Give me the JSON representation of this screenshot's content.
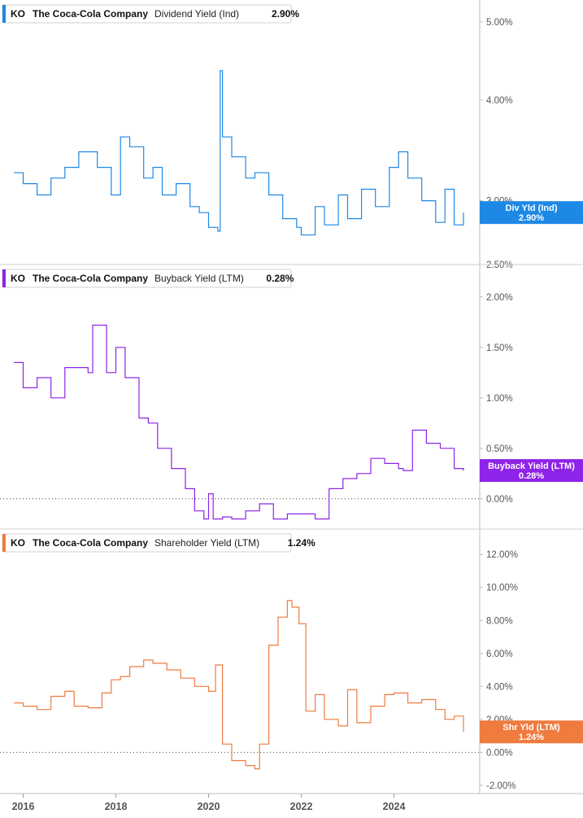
{
  "chart_data": [
    {
      "type": "line",
      "ticker": "KO",
      "company": "The Coca-Cola Company",
      "metric": "Dividend Yield (Ind)",
      "current_value": "2.90%",
      "flag_label": "Div Yld (Ind)",
      "color": "#1e88e5",
      "y_scale": "log",
      "ylim": [
        2.5,
        5.2
      ],
      "y_ticks": [
        "5.00%",
        "4.00%",
        "3.00%",
        "2.50%"
      ],
      "y_tick_values": [
        5.0,
        4.0,
        3.0,
        2.5
      ],
      "x": [
        2015.8,
        2016.0,
        2016.3,
        2016.6,
        2016.9,
        2017.2,
        2017.6,
        2017.9,
        2018.1,
        2018.3,
        2018.6,
        2018.8,
        2019.0,
        2019.3,
        2019.6,
        2019.8,
        2020.0,
        2020.2,
        2020.25,
        2020.3,
        2020.5,
        2020.8,
        2021.0,
        2021.3,
        2021.6,
        2021.9,
        2022.0,
        2022.3,
        2022.5,
        2022.8,
        2023.0,
        2023.3,
        2023.6,
        2023.9,
        2024.1,
        2024.3,
        2024.6,
        2024.9,
        2025.1,
        2025.3,
        2025.5
      ],
      "values": [
        3.25,
        3.15,
        3.05,
        3.2,
        3.3,
        3.45,
        3.3,
        3.05,
        3.6,
        3.5,
        3.2,
        3.3,
        3.05,
        3.15,
        2.95,
        2.9,
        2.78,
        2.75,
        4.35,
        3.6,
        3.4,
        3.2,
        3.25,
        3.05,
        2.85,
        2.78,
        2.72,
        2.95,
        2.8,
        3.05,
        2.85,
        3.1,
        2.95,
        3.3,
        3.45,
        3.2,
        3.0,
        2.82,
        3.1,
        2.8,
        2.9
      ]
    },
    {
      "type": "line",
      "ticker": "KO",
      "company": "The Coca-Cola Company",
      "metric": "Buyback Yield (LTM)",
      "current_value": "0.28%",
      "flag_label": "Buyback Yield (LTM)",
      "color": "#8e24e8",
      "ylim": [
        -0.3,
        2.2
      ],
      "y_ticks": [
        "2.00%",
        "1.50%",
        "1.00%",
        "0.50%",
        "0.00%"
      ],
      "y_tick_values": [
        2.0,
        1.5,
        1.0,
        0.5,
        0.0
      ],
      "x": [
        2015.8,
        2016.0,
        2016.3,
        2016.6,
        2016.9,
        2017.2,
        2017.4,
        2017.5,
        2017.8,
        2018.0,
        2018.2,
        2018.5,
        2018.7,
        2018.9,
        2019.2,
        2019.5,
        2019.7,
        2019.9,
        2020.0,
        2020.1,
        2020.3,
        2020.5,
        2020.8,
        2021.1,
        2021.4,
        2021.7,
        2022.0,
        2022.3,
        2022.6,
        2022.9,
        2023.2,
        2023.5,
        2023.8,
        2024.1,
        2024.2,
        2024.4,
        2024.7,
        2025.0,
        2025.3,
        2025.5
      ],
      "values": [
        1.35,
        1.1,
        1.2,
        1.0,
        1.3,
        1.3,
        1.25,
        1.72,
        1.25,
        1.5,
        1.2,
        0.8,
        0.75,
        0.5,
        0.3,
        0.1,
        -0.12,
        -0.2,
        0.05,
        -0.2,
        -0.18,
        -0.2,
        -0.12,
        -0.05,
        -0.2,
        -0.15,
        -0.15,
        -0.2,
        0.1,
        0.2,
        0.25,
        0.4,
        0.35,
        0.3,
        0.28,
        0.68,
        0.55,
        0.5,
        0.3,
        0.28
      ]
    },
    {
      "type": "line",
      "ticker": "KO",
      "company": "The Coca-Cola Company",
      "metric": "Shareholder Yield (LTM)",
      "current_value": "1.24%",
      "flag_label": "Shr Yld (LTM)",
      "color": "#f07b3f",
      "ylim": [
        -2.5,
        12.8
      ],
      "y_ticks": [
        "12.00%",
        "10.00%",
        "8.00%",
        "6.00%",
        "4.00%",
        "2.00%",
        "0.00%",
        "-2.00%"
      ],
      "y_tick_values": [
        12,
        10,
        8,
        6,
        4,
        2,
        0,
        -2
      ],
      "x": [
        2015.8,
        2016.0,
        2016.3,
        2016.6,
        2016.9,
        2017.1,
        2017.4,
        2017.7,
        2017.9,
        2018.1,
        2018.3,
        2018.6,
        2018.8,
        2019.1,
        2019.4,
        2019.7,
        2020.0,
        2020.15,
        2020.3,
        2020.5,
        2020.8,
        2021.0,
        2021.1,
        2021.3,
        2021.5,
        2021.7,
        2021.8,
        2021.95,
        2022.1,
        2022.3,
        2022.5,
        2022.8,
        2023.0,
        2023.2,
        2023.5,
        2023.8,
        2024.0,
        2024.3,
        2024.6,
        2024.9,
        2025.1,
        2025.3,
        2025.5
      ],
      "values": [
        3.0,
        2.8,
        2.6,
        3.4,
        3.7,
        2.8,
        2.7,
        3.6,
        4.4,
        4.6,
        5.2,
        5.6,
        5.4,
        5.0,
        4.5,
        4.0,
        3.7,
        5.3,
        0.5,
        -0.5,
        -0.8,
        -1.0,
        0.5,
        6.5,
        8.2,
        9.2,
        8.8,
        7.8,
        2.5,
        3.5,
        2.0,
        1.6,
        3.8,
        1.8,
        2.8,
        3.5,
        3.6,
        3.0,
        3.2,
        2.6,
        2.0,
        2.2,
        1.24
      ]
    }
  ],
  "x_axis": {
    "ticks": [
      "2016",
      "2018",
      "2020",
      "2022",
      "2024"
    ],
    "tick_values": [
      2016,
      2018,
      2020,
      2022,
      2024
    ],
    "xlim": [
      2015.5,
      2025.85
    ]
  }
}
